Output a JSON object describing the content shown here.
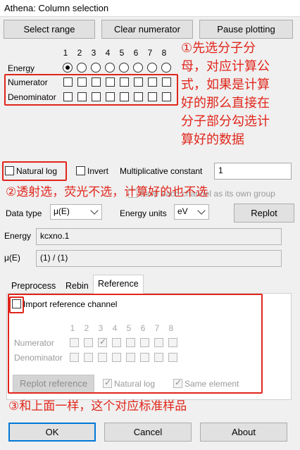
{
  "window": {
    "title": "Athena: Column selection"
  },
  "toolbar": {
    "select_range": "Select range",
    "clear_numerator": "Clear numerator",
    "pause_plotting": "Pause plotting"
  },
  "grid": {
    "columns": [
      "1",
      "2",
      "3",
      "4",
      "5",
      "6",
      "7",
      "8"
    ],
    "energy_label": "Energy",
    "numerator_label": "Numerator",
    "denominator_label": "Denominator",
    "energy_selected_column": "1"
  },
  "options": {
    "natural_log": "Natural log",
    "invert": "Invert",
    "mult_constant_label": "Multiplicative constant",
    "mult_constant_value": "1",
    "save_each_channel": "Save each channel as its own group"
  },
  "datatype": {
    "label": "Data type",
    "value": "μ(E)",
    "energy_units_label": "Energy units",
    "energy_units_value": "eV",
    "replot": "Replot"
  },
  "info": {
    "energy_label": "Energy",
    "energy_value": "kcxno.1",
    "mu_label": "μ(E)",
    "mu_value": "(1) / (1)"
  },
  "tabs": [
    "Preprocess",
    "Rebin",
    "Reference"
  ],
  "active_tab": "Reference",
  "reference": {
    "import_label": "Import reference channel",
    "columns": [
      "1",
      "2",
      "3",
      "4",
      "5",
      "6",
      "7",
      "8"
    ],
    "numerator_label": "Numerator",
    "denominator_label": "Denominator",
    "numerator_checked_column": "3",
    "replot_reference": "Replot reference",
    "natural_log": "Natural log",
    "same_element": "Same element"
  },
  "footer": {
    "ok": "OK",
    "cancel": "Cancel",
    "about": "About"
  },
  "annotations": {
    "note1": [
      "①先选分子分",
      "母，对应计算公",
      "式，如果是计算",
      "好的那么直接在",
      "分子部分勾选计",
      "算好的数据"
    ],
    "note2": "②透射选，荧光不选，计算好的也不选",
    "note3": "③和上面一样，这个对应标准样品"
  },
  "colors": {
    "annotation_red": "#e0261b",
    "default_button_blue": "#0078d7"
  }
}
